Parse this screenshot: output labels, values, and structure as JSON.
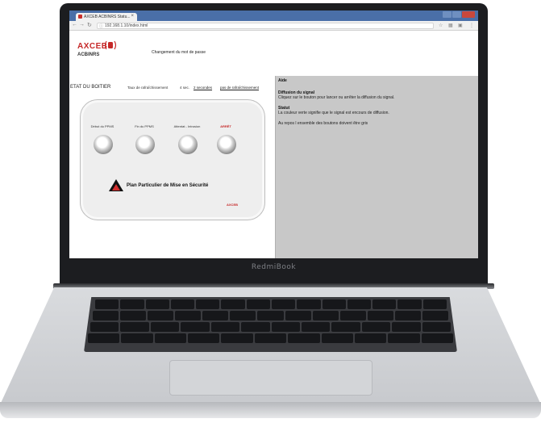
{
  "laptop": {
    "brand": "RedmiBook"
  },
  "browser": {
    "tab_title": "AXCEB ACBINRS Statu...",
    "url": "192.168.1.10/index.html"
  },
  "header": {
    "logo": "AXCEB",
    "product": "ACBINRS",
    "password_link": "Changement du mot de passe"
  },
  "status": {
    "title": "ETAT DU BOITIER",
    "refresh_label": "Taux de rafraîchissement",
    "refresh_value": "4 sec.",
    "refresh_options": [
      "2 secondes",
      "pas de rafraîchissement"
    ]
  },
  "device": {
    "buttons": [
      {
        "label": "Début du PPMS"
      },
      {
        "label": "Fin du PPMS"
      },
      {
        "label": "Attentat - Intrusion"
      },
      {
        "label": "ARRÊT"
      }
    ],
    "plan_text": "Plan Particulier de Mise en Sécurité",
    "logo": "AXCEB"
  },
  "help": {
    "title": "Aide",
    "section1_title": "Diffusion du signal",
    "section1_text": "Cliquez sur le bouton pour lancer ou arrêter la diffusion du signal.",
    "section2_title": "Statut",
    "section2_text": "La couleur verte signifie que le signal est encours de diffusion.",
    "rest_text": "Au repos l ensemble des boutons doivent être gris"
  },
  "colors": {
    "brand_red": "#c62828",
    "help_background": "#c8c8c8",
    "titlebar": "#4a6fa8"
  }
}
